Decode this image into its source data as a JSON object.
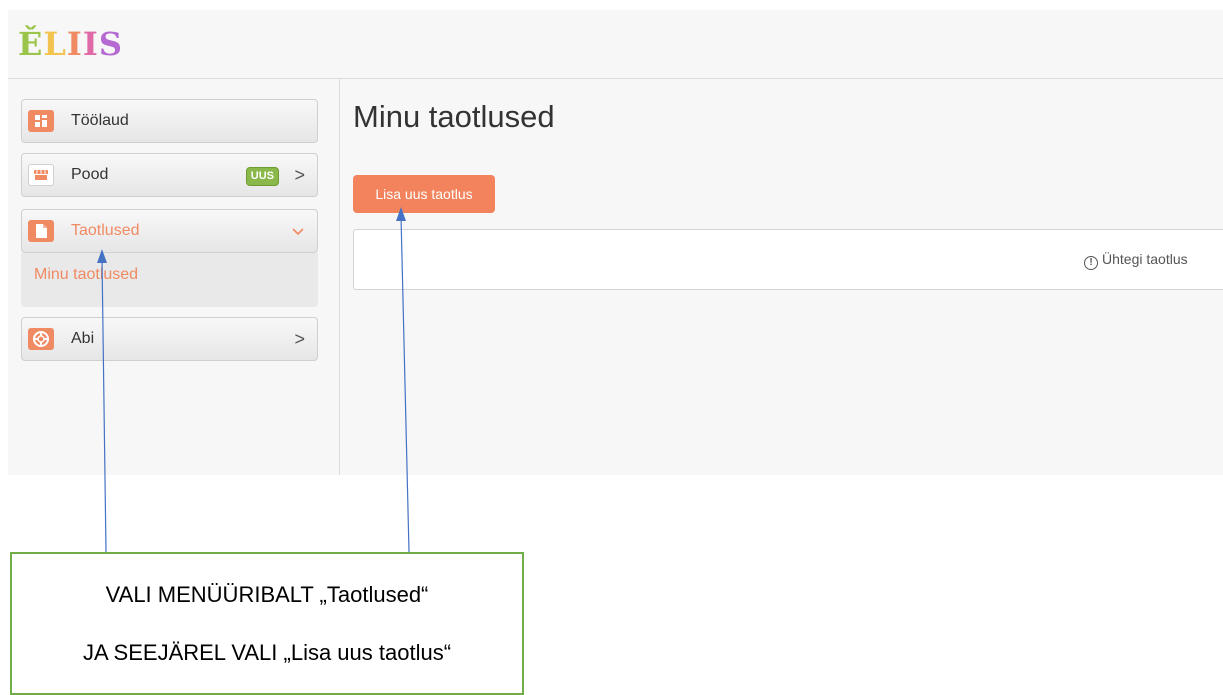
{
  "app": {
    "logo": [
      "Ě",
      "L",
      "I",
      "I",
      "S"
    ],
    "logo_colors": [
      "#9bc44a",
      "#f2c34f",
      "#f08a63",
      "#e06aa8",
      "#b46ad0"
    ]
  },
  "sidebar": {
    "items": [
      {
        "label": "Töölaud",
        "icon": "dashboard-icon"
      },
      {
        "label": "Pood",
        "icon": "shop-icon",
        "badge": "UUS",
        "chevron": ">"
      },
      {
        "label": "Taotlused",
        "icon": "document-icon",
        "chevron": "v",
        "active": true
      },
      {
        "label": "Abi",
        "icon": "lifebuoy-icon",
        "chevron": ">"
      }
    ],
    "submenu": {
      "label": "Minu taotlused"
    }
  },
  "main": {
    "title": "Minu taotlused",
    "add_button": "Lisa uus taotlus",
    "empty_message": "Ühtegi taotlus"
  },
  "annotation": {
    "line1": "VALI MENÜÜRIBALT „Taotlused“",
    "line2": "JA SEEJÄREL VALI „Lisa uus taotlus“"
  },
  "colors": {
    "accent": "#f08a63",
    "badge": "#8ab84a",
    "arrow": "#4472c4",
    "annotation_border": "#70ad47"
  }
}
